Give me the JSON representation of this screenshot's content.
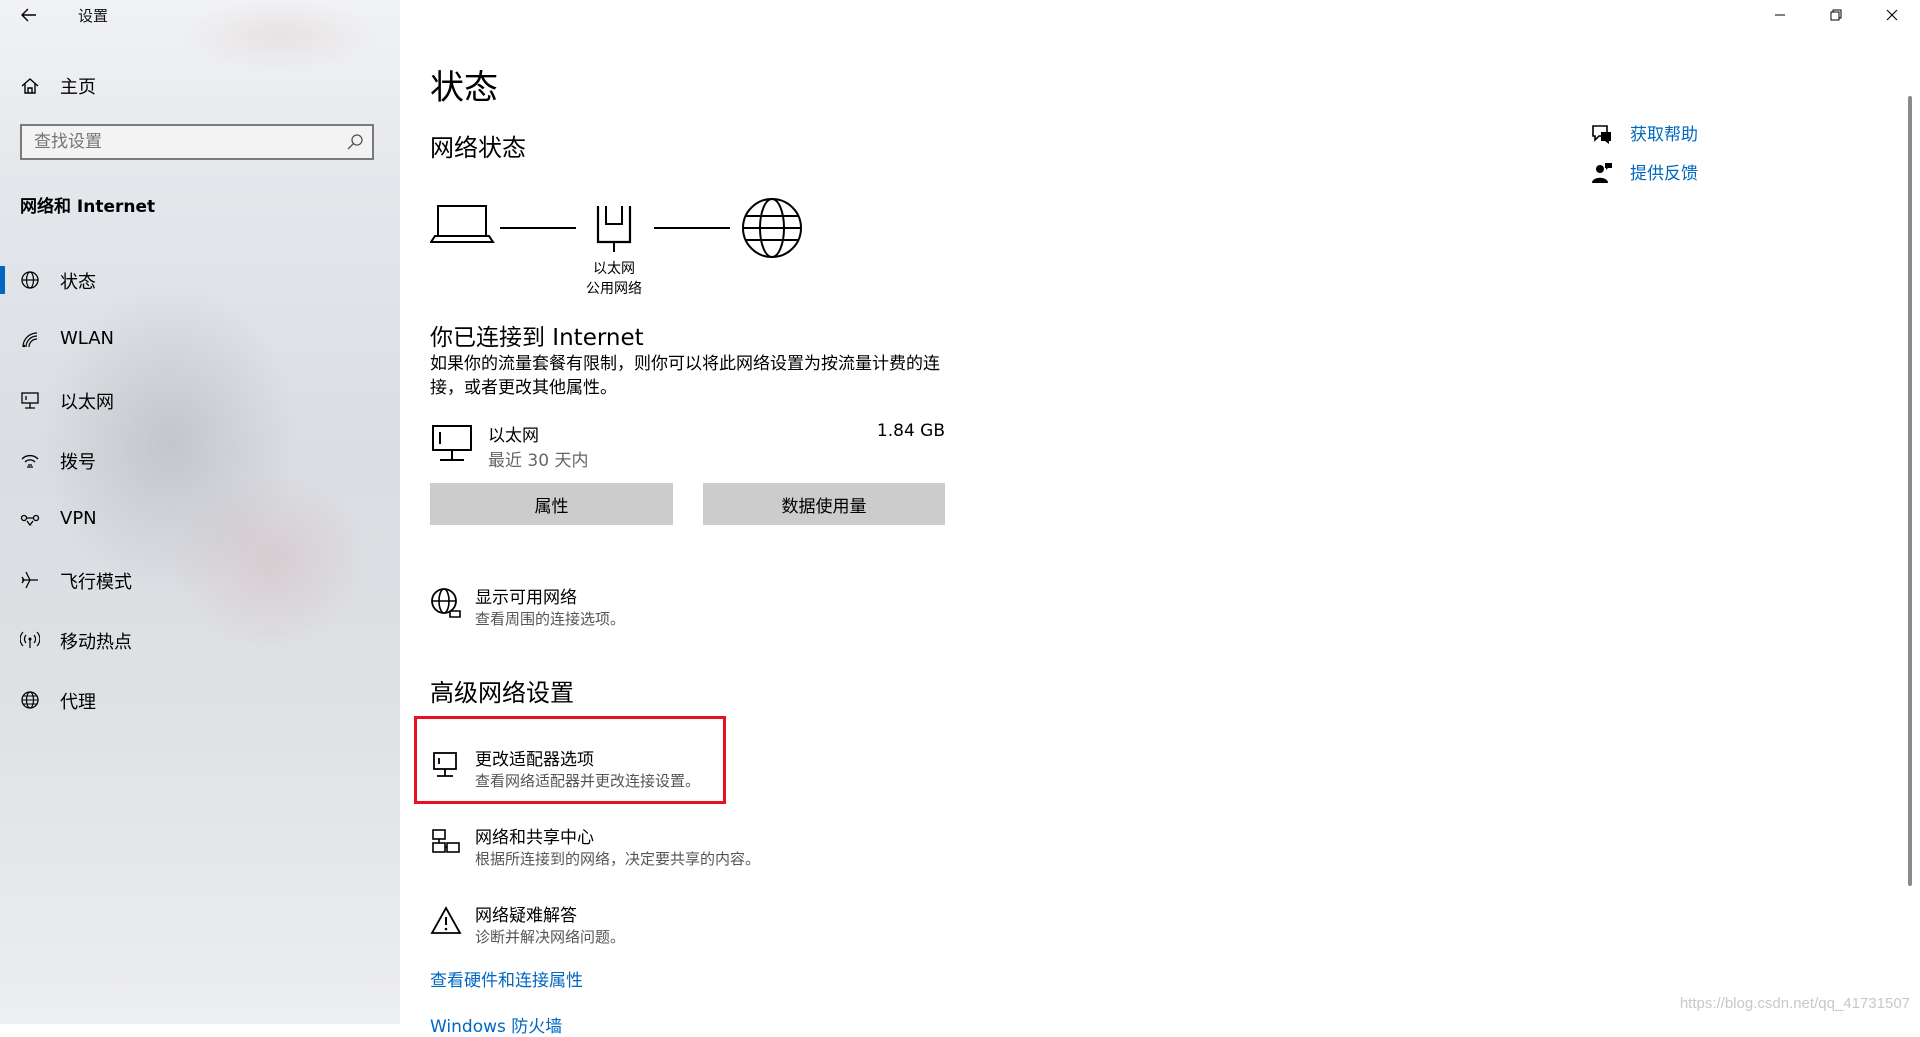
{
  "window": {
    "title": "设置"
  },
  "sidebar": {
    "home_label": "主页",
    "search_placeholder": "查找设置",
    "section_title": "网络和 Internet",
    "items": [
      {
        "label": "状态",
        "icon": "globe-status-icon",
        "active": true
      },
      {
        "label": "WLAN",
        "icon": "wifi-icon",
        "active": false
      },
      {
        "label": "以太网",
        "icon": "ethernet-icon",
        "active": false
      },
      {
        "label": "拨号",
        "icon": "dialup-icon",
        "active": false
      },
      {
        "label": "VPN",
        "icon": "vpn-icon",
        "active": false
      },
      {
        "label": "飞行模式",
        "icon": "airplane-icon",
        "active": false
      },
      {
        "label": "移动热点",
        "icon": "hotspot-icon",
        "active": false
      },
      {
        "label": "代理",
        "icon": "globe-icon",
        "active": false
      }
    ]
  },
  "main": {
    "page_title": "状态",
    "network_status_heading": "网络状态",
    "diagram": {
      "adapter_name": "以太网",
      "network_type": "公用网络"
    },
    "connection_title": "你已连接到 Internet",
    "connection_desc": "如果你的流量套餐有限制，则你可以将此网络设置为按流量计费的连接，或者更改其他属性。",
    "ethernet": {
      "name": "以太网",
      "period": "最近 30 天内",
      "usage": "1.84 GB"
    },
    "buttons": {
      "properties": "属性",
      "data_usage": "数据使用量"
    },
    "show_networks": {
      "title": "显示可用网络",
      "desc": "查看周围的连接选项。"
    },
    "advanced_heading": "高级网络设置",
    "advanced": [
      {
        "title": "更改适配器选项",
        "desc": "查看网络适配器并更改连接设置。"
      },
      {
        "title": "网络和共享中心",
        "desc": "根据所连接到的网络，决定要共享的内容。"
      },
      {
        "title": "网络疑难解答",
        "desc": "诊断并解决网络问题。"
      }
    ],
    "links": {
      "hardware": "查看硬件和连接属性",
      "firewall": "Windows 防火墙"
    },
    "help": {
      "get_help": "获取帮助",
      "feedback": "提供反馈"
    }
  },
  "watermark": "https://blog.csdn.net/qq_41731507",
  "colors": {
    "accent": "#0067c0",
    "highlight": "#e81123"
  }
}
